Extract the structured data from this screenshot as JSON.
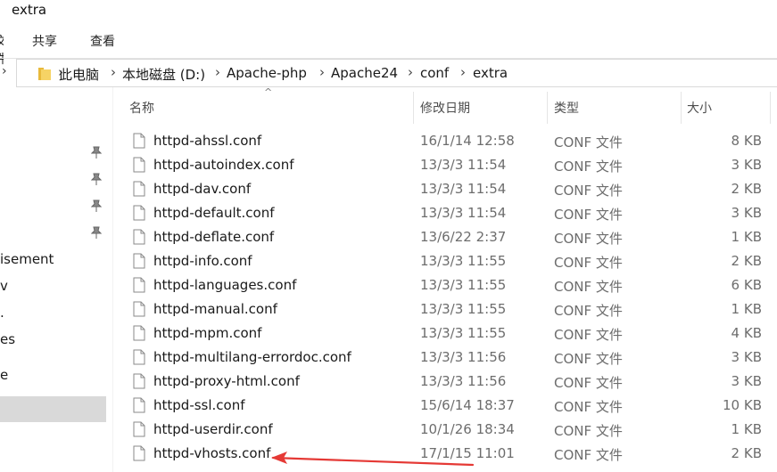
{
  "window": {
    "title": "extra"
  },
  "ribbon": {
    "tabs": [
      "文件",
      "共享",
      "查看"
    ]
  },
  "address": {
    "crumbs": [
      "此电脑",
      "本地磁盘 (D:)",
      "Apache-php",
      "Apache24",
      "conf",
      "extra"
    ]
  },
  "nav": {
    "items": [
      "isement",
      "v",
      ".",
      "es",
      "e"
    ]
  },
  "columns": {
    "name": "名称",
    "date": "修改日期",
    "type": "类型",
    "size": "大小"
  },
  "files": [
    {
      "name": "httpd-ahssl.conf",
      "date": "16/1/14 12:58",
      "type": "CONF 文件",
      "size": "8 KB"
    },
    {
      "name": "httpd-autoindex.conf",
      "date": "13/3/3 11:54",
      "type": "CONF 文件",
      "size": "3 KB"
    },
    {
      "name": "httpd-dav.conf",
      "date": "13/3/3 11:54",
      "type": "CONF 文件",
      "size": "2 KB"
    },
    {
      "name": "httpd-default.conf",
      "date": "13/3/3 11:54",
      "type": "CONF 文件",
      "size": "3 KB"
    },
    {
      "name": "httpd-deflate.conf",
      "date": "13/6/22 2:37",
      "type": "CONF 文件",
      "size": "1 KB"
    },
    {
      "name": "httpd-info.conf",
      "date": "13/3/3 11:55",
      "type": "CONF 文件",
      "size": "2 KB"
    },
    {
      "name": "httpd-languages.conf",
      "date": "13/3/3 11:55",
      "type": "CONF 文件",
      "size": "6 KB"
    },
    {
      "name": "httpd-manual.conf",
      "date": "13/3/3 11:55",
      "type": "CONF 文件",
      "size": "1 KB"
    },
    {
      "name": "httpd-mpm.conf",
      "date": "13/3/3 11:55",
      "type": "CONF 文件",
      "size": "4 KB"
    },
    {
      "name": "httpd-multilang-errordoc.conf",
      "date": "13/3/3 11:56",
      "type": "CONF 文件",
      "size": "3 KB"
    },
    {
      "name": "httpd-proxy-html.conf",
      "date": "13/3/3 11:56",
      "type": "CONF 文件",
      "size": "3 KB"
    },
    {
      "name": "httpd-ssl.conf",
      "date": "15/6/14 18:37",
      "type": "CONF 文件",
      "size": "10 KB"
    },
    {
      "name": "httpd-userdir.conf",
      "date": "10/1/26 18:34",
      "type": "CONF 文件",
      "size": "1 KB"
    },
    {
      "name": "httpd-vhosts.conf",
      "date": "17/1/15 11:01",
      "type": "CONF 文件",
      "size": "2 KB"
    }
  ],
  "colors": {
    "annotation": "#e53935",
    "selection": "#d9d9d9",
    "folder": "#e8b93b"
  }
}
